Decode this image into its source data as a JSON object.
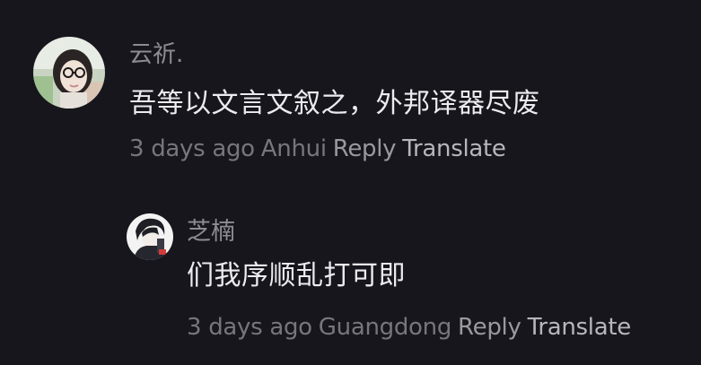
{
  "comments": [
    {
      "username": "云祈.",
      "text": "吾等以文言文叙之，外邦译器尽废",
      "time": "3 days ago",
      "location": "Anhui",
      "reply_label": "Reply",
      "translate_label": "Translate"
    },
    {
      "username": "芝楠",
      "text": "们我序顺乱打可即",
      "time": "3 days ago",
      "location": "Guangdong",
      "reply_label": "Reply",
      "translate_label": "Translate"
    }
  ],
  "colors": {
    "background": "#17161c",
    "text": "#ececf0",
    "username": "#8d8c94",
    "meta": "#77767e",
    "translate": "#b7b6be"
  }
}
